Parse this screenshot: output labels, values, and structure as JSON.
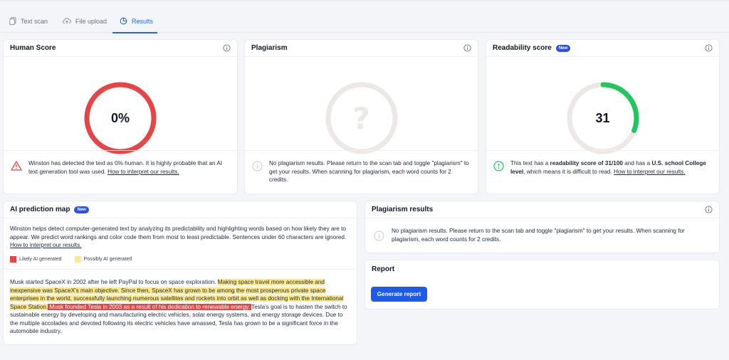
{
  "tabs": [
    {
      "label": "Text scan",
      "icon": "copy-icon"
    },
    {
      "label": "File upload",
      "icon": "cloud-upload-icon"
    },
    {
      "label": "Results",
      "icon": "results-icon"
    }
  ],
  "human_score": {
    "title": "Human Score",
    "value": "0%",
    "percent": 0,
    "ring_color": "#e64545",
    "message_lead": "Winston has detected the text as 0% human. It is highly probable that an AI text generation tool was used. ",
    "link": "How to interpret our results."
  },
  "plagiarism": {
    "title": "Plagiarism",
    "symbol": "?",
    "message": "No plagiarism results. Please return to the scan tab and toggle \"plagiarism\" to get your results. When scanning for plagiarism, each word counts for 2 credits."
  },
  "readability": {
    "title": "Readability score",
    "badge": "New",
    "value": "31",
    "score_fraction": 0.31,
    "ring_color": "#22c55e",
    "msg_1": "This text has a ",
    "msg_bold_1": "readability score of 31/100",
    "msg_2": " and has a ",
    "msg_bold_2": "U.S. school College level",
    "msg_3": ", which means it is difficult to read. ",
    "link": "How to interpret our results."
  },
  "ai_map": {
    "title": "AI prediction map",
    "badge": "New",
    "description": "Winston helps detect computer-generated text by analyzing its predictability and highlighting words based on how likely they are to appear. We predict word rankings and color code them from most to least predictable. Sentences under 60 characters are ignored. ",
    "link": "How to interpret our results.",
    "legend_likely": "Likely AI generated",
    "legend_possibly": "Possibly AI generated",
    "legend_likely_color": "#e64545",
    "legend_possibly_color": "#fde98c",
    "seg1": "Musk started SpaceX in 2002 after he left PayPal to focus on space exploration. ",
    "seg2": "Making space travel more accessible and inexpensive was SpaceX's main objective. Since then, SpaceX has grown to be among the most prosperous private space enterprises in the world, successfully launching numerous satellites and rockets into orbit as well as docking with the International Space Station.",
    "seg3": " Musk founded Tesla in 2003 as a result of his dedication to renewable energy. ",
    "seg4": "Tesla's goal is to hasten the switch to sustainable energy by developing and manufacturing electric vehicles, solar energy systems, and energy storage devices. Due to the multiple accolades and devoted following its electric vehicles have amassed, Tesla has grown to be a significant force in the automobile industry."
  },
  "plagiarism_results": {
    "title": "Plagiarism results",
    "message": "No plagiarism results. Please return to the scan tab and toggle \"plagiarism\" to get your results. When scanning for plagiarism, each word counts for 2 credits."
  },
  "report": {
    "title": "Report",
    "button": "Generate report"
  }
}
